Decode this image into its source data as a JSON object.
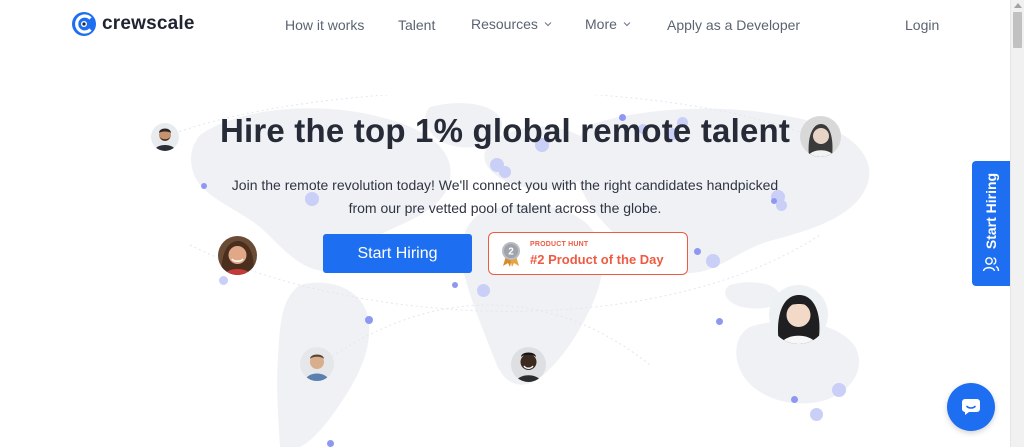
{
  "brand": {
    "name": "crewscale",
    "accent": "#1d6ef0",
    "highlight": "#ee5a42"
  },
  "nav": {
    "items": [
      {
        "label": "How it works",
        "dropdown": false
      },
      {
        "label": "Talent",
        "dropdown": false
      },
      {
        "label": "Resources",
        "dropdown": true
      },
      {
        "label": "More",
        "dropdown": true
      },
      {
        "label": "Apply as a Developer",
        "dropdown": false
      }
    ],
    "login": "Login"
  },
  "hero": {
    "title": "Hire the top 1% global remote talent",
    "subtitle_line1": "Join the remote revolution today! We'll connect you with the right candidates handpicked",
    "subtitle_line2": "from our pre vetted pool of talent across the globe.",
    "cta": "Start Hiring"
  },
  "product_hunt": {
    "rank_badge": "2",
    "kicker": "PRODUCT HUNT",
    "label": "#2 Product of the Day"
  },
  "side_tab": {
    "label": "Start Hiring",
    "icon": "users-icon"
  },
  "chat": {
    "icon": "chat-icon"
  }
}
